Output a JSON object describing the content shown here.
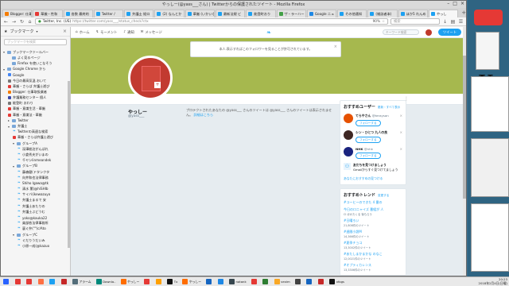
{
  "window": {
    "title": "やっしー(@yass___さん) | Twitterからの保護されたツイート - Mozilla Firefox",
    "controls": [
      "–",
      "□",
      "×"
    ]
  },
  "tabs": [
    {
      "label": "Blogger: 仕事の",
      "color": "#f57c00"
    },
    {
      "label": "華厳・性和",
      "color": "#e53935"
    },
    {
      "label": "各数 最終的",
      "color": "#1da1f2"
    },
    {
      "label": "Twitter / ",
      "color": "#1da1f2"
    },
    {
      "label": "弁護士 縦ロ",
      "color": "#1da1f2"
    },
    {
      "label": "(2) なんとか",
      "color": "#1da1f2"
    },
    {
      "label": "華厳 (いかいな",
      "color": "#1da1f2"
    },
    {
      "label": "最新法規 ビ",
      "color": "#1da1f2"
    },
    {
      "label": "能登町おり",
      "color": "#1da1f2"
    },
    {
      "label": "ザ・ラーハー",
      "color": "#43a047"
    },
    {
      "label": "Google ニュ",
      "color": "#1e88e5"
    },
    {
      "label": "その他通知",
      "color": "#1da1f2"
    },
    {
      "label": "(雑誌者本)",
      "color": "#1da1f2"
    },
    {
      "label": "ほか5 れんめ",
      "color": "#1da1f2"
    },
    {
      "label": "やっし",
      "color": "#1da1f2",
      "active": true
    }
  ],
  "navbar": {
    "url_host": "Twitter, Inc. (US)",
    "url_path": "https://twitter.com/yass___/status_check?ctx",
    "zoom": "90%",
    "search_placeholder": "検索"
  },
  "sidebar": {
    "title": "ブックマーク",
    "search_placeholder": "ブックマークを検索",
    "items": [
      {
        "label": "ブックマークツールバー",
        "kind": "folder",
        "indent": 0,
        "arrow": "▾"
      },
      {
        "label": "よく見るページ",
        "kind": "folder",
        "indent": 1,
        "arrow": ""
      },
      {
        "label": "Firefox を使いこなそう",
        "kind": "folder",
        "indent": 1,
        "arrow": ""
      },
      {
        "label": "Google Chrome から",
        "kind": "folder",
        "indent": 0,
        "arrow": "▾"
      },
      {
        "label": "Google",
        "kind": "page",
        "indent": 1,
        "color": "#4285f4"
      },
      {
        "label": "今日の最高気温 おいて",
        "kind": "page",
        "indent": 1,
        "color": "#777"
      },
      {
        "label": "華厳・さらば 弁護士遊び",
        "kind": "page",
        "indent": 1,
        "color": "#e53935"
      },
      {
        "label": "Blogger: 仕事取扱業者",
        "kind": "page",
        "indent": 1,
        "color": "#f57c00"
      },
      {
        "label": "弁護業務センター 個人",
        "kind": "page",
        "indent": 1,
        "color": "#3949ab"
      },
      {
        "label": "能登町 おわり",
        "kind": "page",
        "indent": 1,
        "color": "#777"
      },
      {
        "label": "華厳・意識生活 - 華厳",
        "kind": "page",
        "indent": 1,
        "color": "#e53935"
      },
      {
        "label": "華厳・意識法 - 華厳",
        "kind": "page",
        "indent": 1,
        "color": "#e53935"
      },
      {
        "label": "Twitter",
        "kind": "folder",
        "indent": 1,
        "arrow": "▸"
      },
      {
        "label": "弁護士",
        "kind": "folder",
        "indent": 1,
        "arrow": "▾"
      },
      {
        "label": "Twitterの高速な検索",
        "kind": "tw",
        "indent": 2
      },
      {
        "label": "華厳・さらば弁護士遊び",
        "kind": "page",
        "indent": 2,
        "color": "#e53935"
      },
      {
        "label": "グループA",
        "kind": "folder",
        "indent": 2,
        "arrow": "▾"
      },
      {
        "label": "深澤総治がんばれ",
        "kind": "tw",
        "indent": 3
      },
      {
        "label": "小倉秀夫がいまの",
        "kind": "tw",
        "indent": 3
      },
      {
        "label": "千ヤンlinmeandek",
        "kind": "tw",
        "indent": 3
      },
      {
        "label": "グループB",
        "kind": "folder",
        "indent": 2,
        "arrow": "▾"
      },
      {
        "label": "藤森健(ドタンクタ",
        "kind": "tw",
        "indent": 3
      },
      {
        "label": "向井和也法律事務",
        "kind": "tw",
        "indent": 3
      },
      {
        "label": "Shiho Igawa@tk",
        "kind": "tw",
        "indent": 3
      },
      {
        "label": "清水 薫(@hiSHIb",
        "kind": "tw",
        "indent": 3
      },
      {
        "label": "サイバ(ikewazuyo",
        "kind": "tw",
        "indent": 3
      },
      {
        "label": "弁護士まるで 安",
        "kind": "tw",
        "indent": 3
      },
      {
        "label": "弁護士あたりの",
        "kind": "tw",
        "indent": 3
      },
      {
        "label": "弁護士ぶどうむ",
        "kind": "tw",
        "indent": 3
      },
      {
        "label": "yoko@kauka22",
        "kind": "tw",
        "indent": 3
      },
      {
        "label": "楽部依法律事務所",
        "kind": "tw",
        "indent": 3
      },
      {
        "label": "裏ぐ弁(\"\"(c/Ato",
        "kind": "tw",
        "indent": 3
      },
      {
        "label": "グループC",
        "kind": "folder",
        "indent": 2,
        "arrow": "▾"
      },
      {
        "label": "ぐだりうだいみ",
        "kind": "tw",
        "indent": 3
      },
      {
        "label": "小原一成(@kazuo",
        "kind": "tw",
        "indent": 3
      }
    ]
  },
  "twitter": {
    "nav": [
      {
        "label": "ホーム",
        "icon": "home-icon"
      },
      {
        "label": "モーメント",
        "icon": "lightning-icon"
      },
      {
        "label": "通知",
        "icon": "bell-icon"
      },
      {
        "label": "メッセージ",
        "icon": "mail-icon"
      }
    ],
    "search_placeholder": "キーワード検索",
    "tweet_button": "ツイート",
    "notice": "本人:表示すればこのフォロワーを見ることが許可されています。",
    "profile_name": "やっしー",
    "profile_handle": "@yass___",
    "protected_text": "プロテクトされたあなたの @yass___ さんのツイートは @yass___ さんのツイートは表示されません。",
    "protected_link": "詳細はこちら",
    "suggest_title": "おすすめユーザー",
    "suggest_links": "更新・すべて表示",
    "follow_label": "フォローする",
    "users": [
      {
        "name": "てらやさん",
        "handle": "@teraysan",
        "color": "#e65100"
      },
      {
        "name": "シン・ひとつ 九人の良",
        "handle": "",
        "color": "#3e2723"
      },
      {
        "name": "NHK",
        "handle": "@nhk",
        "color": "#1a237e"
      }
    ],
    "find_friends": "友だちを見つけましょう",
    "find_sub": "Gmailからすぐ見つけてましょう",
    "refresh": "あなたにおすすめの見つける",
    "trends_title": "おすすめトレンド",
    "trends_change": "変更する",
    "trends": [
      {
        "tag": "#コーヒーのできた 4 番の",
        "count": ""
      },
      {
        "tag": "今日のロニャイズ 番組が 人",
        "count": "Cl  ほかたくる 後もらう"
      },
      {
        "tag": "#日曜ろい",
        "count": "21,808件のツイート"
      },
      {
        "tag": "#週間小説M",
        "count": "14,366件のツイート"
      },
      {
        "tag": "#夏季チョコ",
        "count": "13,3002件のツイート"
      },
      {
        "tag": "#あたしまかまかな のなこ",
        "count": "12,0021件のツイート"
      },
      {
        "tag": "#オプティカレンス",
        "count": "13,3306件のツイート"
      }
    ]
  },
  "taskbar": {
    "items": [
      {
        "label": "",
        "color": "#2962ff"
      },
      {
        "label": "",
        "color": "#e53935"
      },
      {
        "label": "",
        "color": "#e53935"
      },
      {
        "label": "",
        "color": "#ff7043"
      },
      {
        "label": "",
        "color": "#1da1f2"
      },
      {
        "label": "",
        "color": "#c62828"
      },
      {
        "label": "アラーム",
        "color": "#546e7a"
      },
      {
        "label": "Downlo..",
        "color": "#00897b"
      },
      {
        "label": "やっしー",
        "color": "#ff6d00"
      },
      {
        "label": "",
        "color": "#e53935"
      },
      {
        "label": "",
        "color": "#ffa000"
      },
      {
        "label": "Tx",
        "color": "#111"
      },
      {
        "label": "やっしー",
        "color": "#ff6d00"
      },
      {
        "label": "",
        "color": "#1565c0"
      },
      {
        "label": "",
        "color": "#1e88e5"
      },
      {
        "label": "notank",
        "color": "#37474f"
      },
      {
        "label": "",
        "color": "#e53935"
      },
      {
        "label": "",
        "color": "#2e7d32"
      },
      {
        "label": "vexim",
        "color": "#f9a825"
      },
      {
        "label": "",
        "color": "#424242"
      },
      {
        "label": "",
        "color": "#1565c0"
      },
      {
        "label": "",
        "color": "#c62828"
      },
      {
        "label": "xfogs",
        "color": "#111"
      }
    ],
    "clock_time": "20:23",
    "clock_date": "2018年2月4日(日曜)"
  }
}
